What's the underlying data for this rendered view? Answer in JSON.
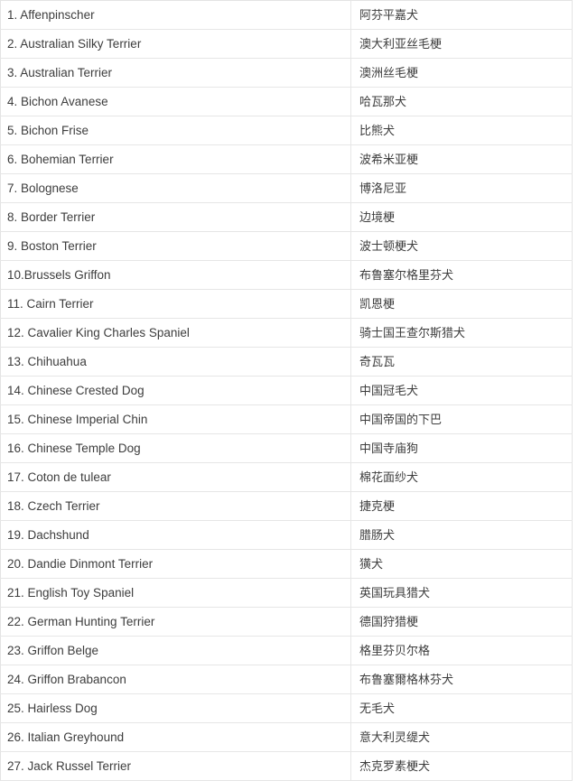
{
  "table": {
    "columns": [
      "english_name",
      "chinese_name"
    ],
    "rows": [
      {
        "english_name": "1. Affenpinscher",
        "chinese_name": "阿芬平嘉犬"
      },
      {
        "english_name": "2. Australian Silky Terrier",
        "chinese_name": "澳大利亚丝毛梗"
      },
      {
        "english_name": "3. Australian Terrier",
        "chinese_name": "澳洲丝毛梗"
      },
      {
        "english_name": "4. Bichon Avanese",
        "chinese_name": "哈瓦那犬"
      },
      {
        "english_name": "5. Bichon Frise",
        "chinese_name": "比熊犬"
      },
      {
        "english_name": "6. Bohemian Terrier",
        "chinese_name": "波希米亚梗"
      },
      {
        "english_name": "7. Bolognese",
        "chinese_name": "博洛尼亚"
      },
      {
        "english_name": "8. Border Terrier",
        "chinese_name": "边境梗"
      },
      {
        "english_name": "9. Boston Terrier",
        "chinese_name": "波士顿梗犬"
      },
      {
        "english_name": "10.Brussels Griffon",
        "chinese_name": "布鲁塞尔格里芬犬"
      },
      {
        "english_name": "11. Cairn Terrier",
        "chinese_name": "凯恩梗"
      },
      {
        "english_name": "12. Cavalier King Charles Spaniel",
        "chinese_name": "骑士国王查尔斯猎犬"
      },
      {
        "english_name": "13. Chihuahua",
        "chinese_name": "奇瓦瓦"
      },
      {
        "english_name": "14. Chinese Crested Dog",
        "chinese_name": "中国冠毛犬"
      },
      {
        "english_name": "15. Chinese Imperial Chin",
        "chinese_name": "中国帝国的下巴"
      },
      {
        "english_name": "16. Chinese Temple Dog",
        "chinese_name": "中国寺庙狗"
      },
      {
        "english_name": "17. Coton de tulear",
        "chinese_name": "棉花面纱犬"
      },
      {
        "english_name": "18. Czech Terrier",
        "chinese_name": "捷克梗"
      },
      {
        "english_name": "19. Dachshund",
        "chinese_name": "腊肠犬"
      },
      {
        "english_name": "20. Dandie Dinmont Terrier",
        "chinese_name": "獚犬"
      },
      {
        "english_name": "21. English Toy Spaniel",
        "chinese_name": "英国玩具猎犬"
      },
      {
        "english_name": "22. German Hunting Terrier",
        "chinese_name": "德国狩猎梗"
      },
      {
        "english_name": "23. Griffon Belge",
        "chinese_name": "格里芬贝尔格"
      },
      {
        "english_name": "24. Griffon Brabancon",
        "chinese_name": "布鲁塞爾格林芬犬"
      },
      {
        "english_name": "25. Hairless Dog",
        "chinese_name": "无毛犬"
      },
      {
        "english_name": "26. Italian Greyhound",
        "chinese_name": "意大利灵缇犬"
      },
      {
        "english_name": "27. Jack Russel Terrier",
        "chinese_name": "杰克罗素梗犬"
      }
    ]
  },
  "colors": {
    "border": "#e6e6e6",
    "text": "#3d3d3d",
    "background": "#ffffff"
  }
}
